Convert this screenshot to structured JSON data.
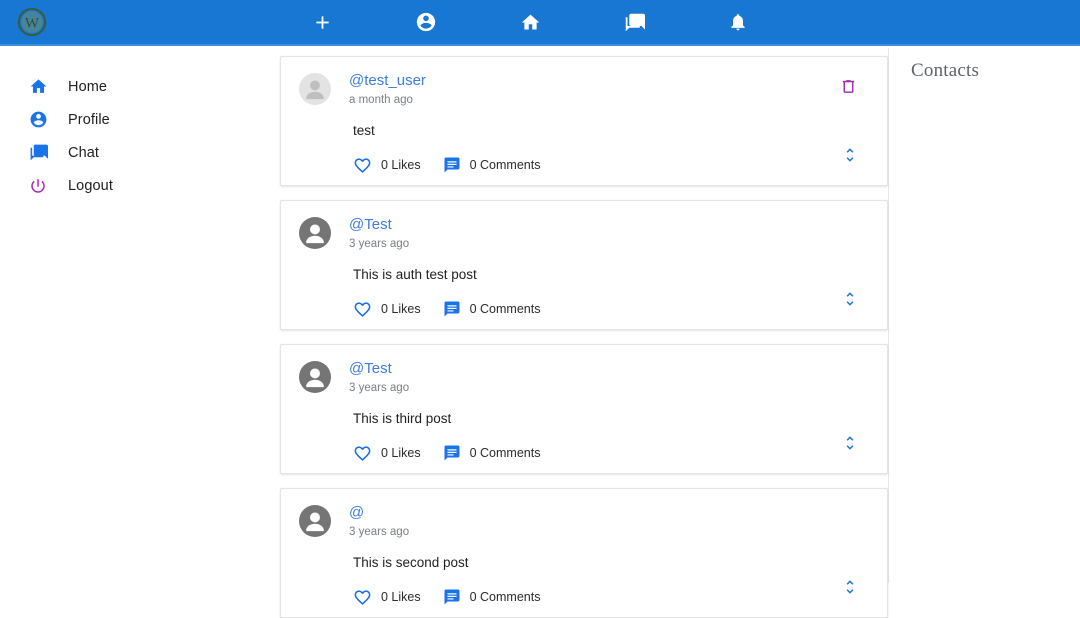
{
  "app": {
    "brand_logo_icon": "wordpress-w-logo",
    "accent_blue": "#1877d2",
    "link_blue": "#3d7ddb",
    "delete_purple": "#9c27b0"
  },
  "topnav": {
    "items": [
      {
        "icon": "plus-icon",
        "label": "Create Post"
      },
      {
        "icon": "account-circle-icon",
        "label": "Profile"
      },
      {
        "icon": "home-icon",
        "label": "Home"
      },
      {
        "icon": "forum-icon",
        "label": "Chat"
      },
      {
        "icon": "notifications-bell-icon",
        "label": "Notifications"
      }
    ]
  },
  "sidebar": {
    "items": [
      {
        "label": "Home",
        "icon": "home-icon",
        "color": "#1a73e8"
      },
      {
        "label": "Profile",
        "icon": "account-circle-icon",
        "color": "#1a73e8"
      },
      {
        "label": "Chat",
        "icon": "forum-icon",
        "color": "#1a73e8"
      },
      {
        "label": "Logout",
        "icon": "power-off-icon",
        "color": "#a42bb5"
      }
    ]
  },
  "feed": {
    "posts": [
      {
        "username": "@test_user",
        "timestamp": "a month ago",
        "body": "test",
        "likes_label": "0 Likes",
        "comments_label": "0 Comments",
        "avatar_style": "light",
        "has_delete": true
      },
      {
        "username": "@Test",
        "timestamp": "3 years ago",
        "body": "This is auth test post",
        "likes_label": "0 Likes",
        "comments_label": "0 Comments",
        "avatar_style": "dark",
        "has_delete": false
      },
      {
        "username": "@Test",
        "timestamp": "3 years ago",
        "body": "This is third post",
        "likes_label": "0 Likes",
        "comments_label": "0 Comments",
        "avatar_style": "dark",
        "has_delete": false
      },
      {
        "username": "@",
        "timestamp": "3 years ago",
        "body": "This is second post",
        "likes_label": "0 Likes",
        "comments_label": "0 Comments",
        "avatar_style": "dark",
        "has_delete": false
      }
    ]
  },
  "contacts": {
    "title": "Contacts"
  }
}
